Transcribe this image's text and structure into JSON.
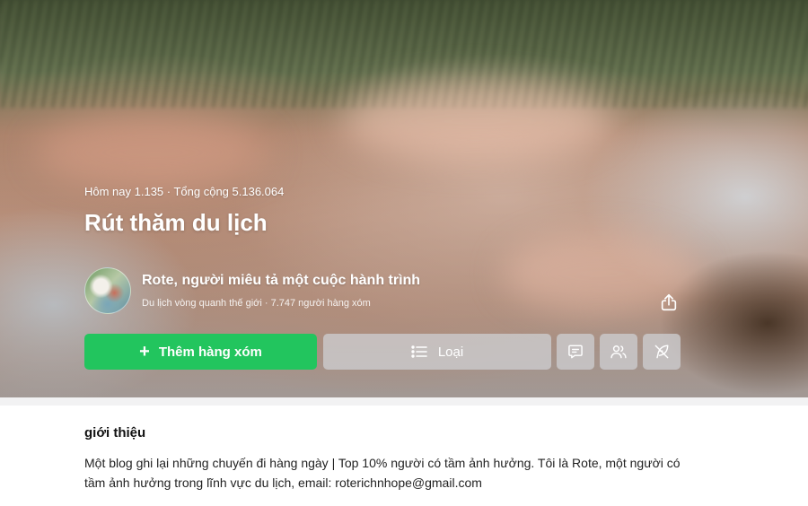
{
  "hero": {
    "stats": "Hôm nay 1.135 · Tổng cộng 5.136.064",
    "title": "Rút thăm du lịch"
  },
  "author": {
    "name": "Rote, người miêu tả một cuộc hành trình",
    "subtitle": "Du lịch vòng quanh thế giới · 7.747 người hàng xóm"
  },
  "actions": {
    "add_label": "Thêm hàng xóm",
    "category_label": "Loại",
    "accent_color": "#22c55e"
  },
  "icons": {
    "share": "share-icon",
    "chat": "chat-icon",
    "people": "people-icon",
    "feather": "feather-icon"
  },
  "intro": {
    "heading": "giới thiệu",
    "text": "Một blog ghi lại những chuyến đi hàng ngày | Top 10% người có tầm ảnh hưởng. Tôi là Rote, một người có tầm ảnh hưởng trong lĩnh vực du lịch, email: roterichnhope@gmail.com"
  }
}
